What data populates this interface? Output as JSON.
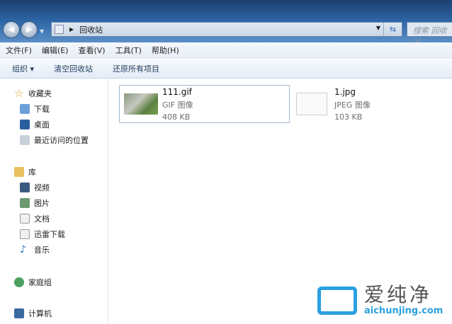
{
  "address": {
    "location": "回收站",
    "search_placeholder": "搜索 回收站"
  },
  "menu": [
    "文件(F)",
    "编辑(E)",
    "查看(V)",
    "工具(T)",
    "帮助(H)"
  ],
  "toolbar": {
    "organize": "组织 ▾",
    "empty": "清空回收站",
    "restore_all": "还原所有项目"
  },
  "sidebar": {
    "favorites": {
      "label": "收藏夹",
      "items": [
        "下载",
        "桌面",
        "最近访问的位置"
      ]
    },
    "libraries": {
      "label": "库",
      "items": [
        "视频",
        "图片",
        "文档",
        "迅雷下载",
        "音乐"
      ]
    },
    "homegroup": "家庭组",
    "computer": "计算机"
  },
  "files": [
    {
      "name": "111.gif",
      "type": "GIF 图像",
      "size": "408 KB"
    },
    {
      "name": "1.jpg",
      "type": "JPEG 图像",
      "size": "103 KB"
    }
  ],
  "watermark": {
    "cn": "爱纯净",
    "en": "aichunjing.com"
  }
}
